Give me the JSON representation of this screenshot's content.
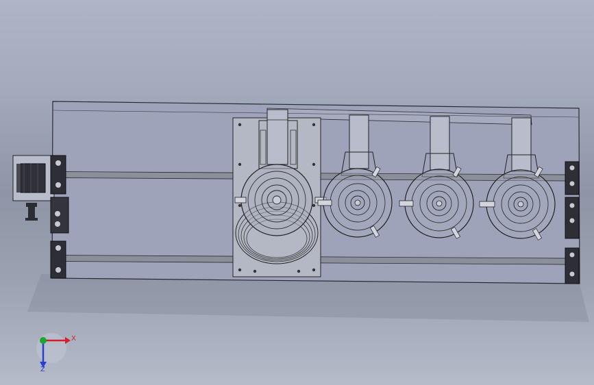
{
  "view": {
    "background_top": "#aeb5c6",
    "background_bottom": "#b5bbc9",
    "plate_color": "#9da1b8",
    "edge_color": "#1e1e26",
    "rod_color": "#8a8e99"
  },
  "model": {
    "stations": [
      {
        "id": "station-1",
        "type": "main-bowl"
      },
      {
        "id": "station-2",
        "type": "feeder"
      },
      {
        "id": "station-3",
        "type": "feeder"
      },
      {
        "id": "station-4",
        "type": "feeder"
      }
    ]
  },
  "triad": {
    "x_label": "X",
    "y_label": "Y",
    "z_label": "Z",
    "x_color": "#d4202a",
    "y_color": "#1aa830",
    "z_color": "#2a3fd0"
  }
}
